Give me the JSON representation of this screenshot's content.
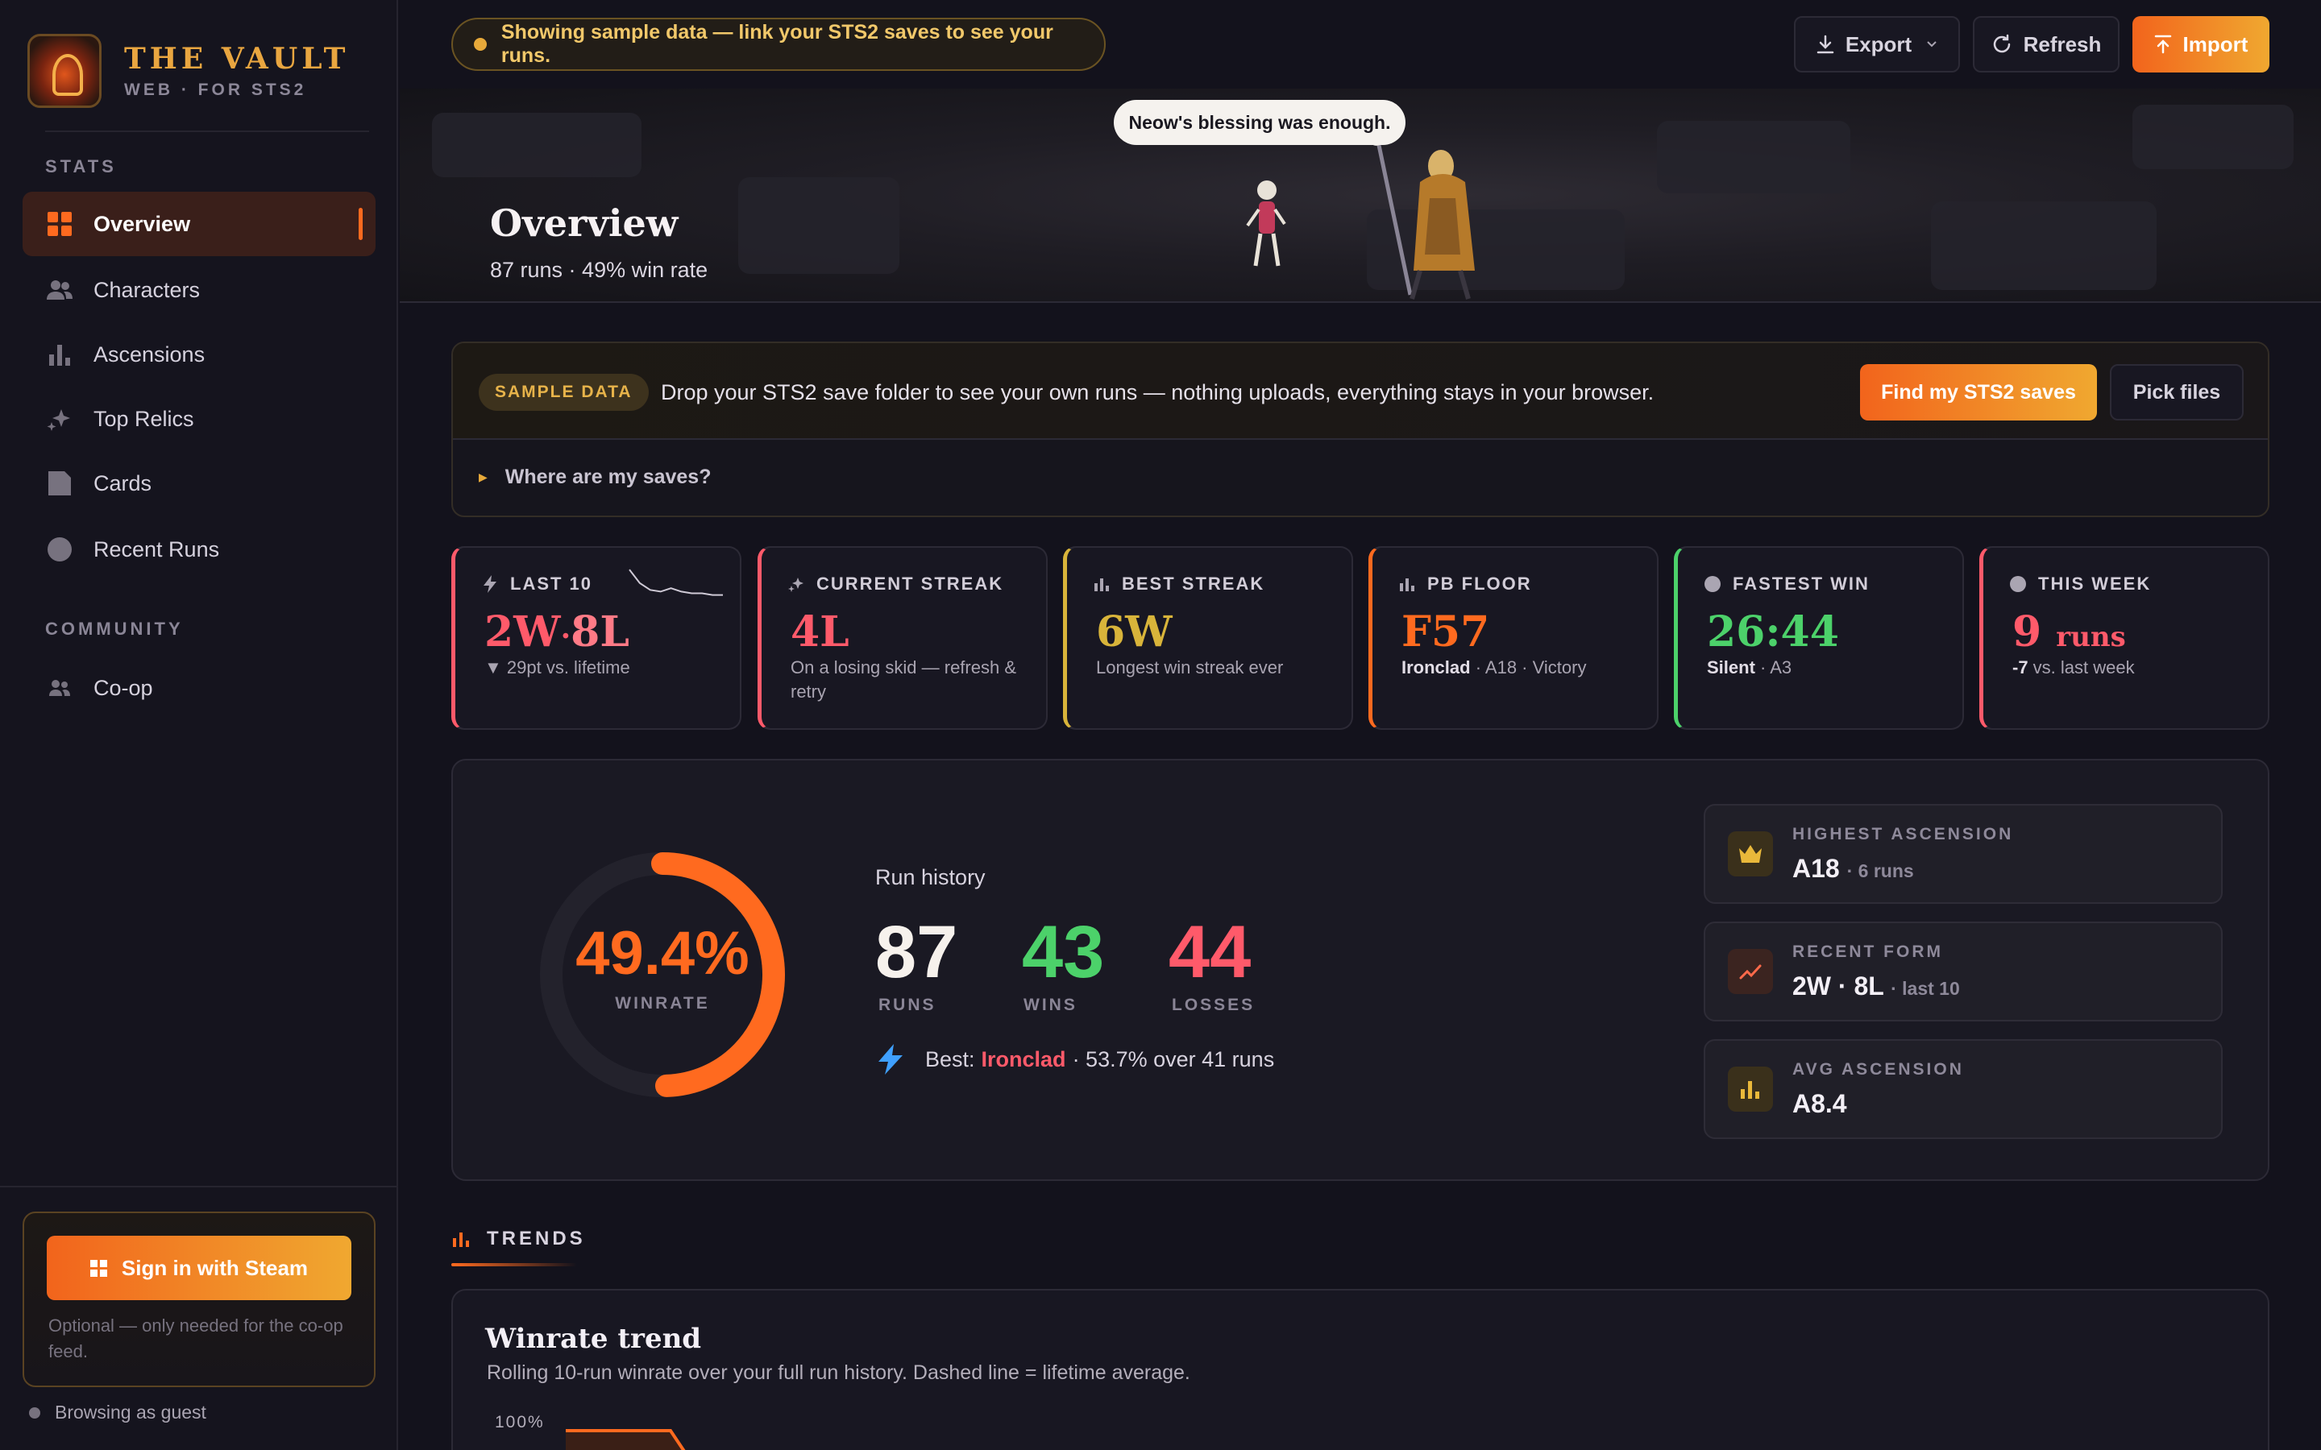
{
  "brand": {
    "title": "THE VAULT",
    "subtitle": "WEB · FOR STS2"
  },
  "sidebar": {
    "section_stats": "STATS",
    "section_community": "COMMUNITY",
    "items": [
      {
        "label": "Overview",
        "icon": "grid-icon",
        "active": true
      },
      {
        "label": "Characters",
        "icon": "users-icon"
      },
      {
        "label": "Ascensions",
        "icon": "bar-chart-icon"
      },
      {
        "label": "Top Relics",
        "icon": "sparkle-icon"
      },
      {
        "label": "Cards",
        "icon": "card-icon"
      },
      {
        "label": "Recent Runs",
        "icon": "circle-icon"
      }
    ],
    "community_items": [
      {
        "label": "Co-op",
        "icon": "users-icon"
      }
    ],
    "steam": {
      "button": "Sign in with Steam",
      "note": "Optional — only needed for the co-op feed."
    },
    "guest": "Browsing as guest"
  },
  "topbar": {
    "sample_notice": "Showing sample data — link your STS2 saves to see your runs.",
    "export": "Export",
    "refresh": "Refresh",
    "import": "Import"
  },
  "hero": {
    "title": "Overview",
    "subtitle": "87 runs · 49% win rate",
    "speech": "Neow's blessing was enough."
  },
  "banner": {
    "badge": "SAMPLE DATA",
    "text": "Drop your STS2 save folder to see your own runs — nothing uploads, everything stays in your browser.",
    "find_button": "Find my STS2 saves",
    "pick_button": "Pick files",
    "where": "Where are my saves?"
  },
  "stats": [
    {
      "label": "LAST 10",
      "value_w": "2W",
      "value_sep": "·",
      "value_l": "8L",
      "note": "▼ 29pt vs. lifetime",
      "accent": "#ff5a6a"
    },
    {
      "label": "CURRENT STREAK",
      "value": "4L",
      "note": "On a losing skid — refresh & retry",
      "accent": "#ff5a6a"
    },
    {
      "label": "BEST STREAK",
      "value": "6W",
      "note": "Longest win streak ever",
      "accent": "#d8b43a"
    },
    {
      "label": "PB FLOOR",
      "value": "F57",
      "note_bold": "Ironclad",
      "note": " · A18 · Victory",
      "accent": "#ff6a1f"
    },
    {
      "label": "FASTEST WIN",
      "value": "26:44",
      "note_bold": "Silent",
      "note": " · A3",
      "accent": "#4cd16a"
    },
    {
      "label": "THIS WEEK",
      "value_num": "9",
      "value_unit": "runs",
      "note_bold": "-7",
      "note": " vs. last week",
      "accent": "#ff5a6a"
    }
  ],
  "last10_sparkline": [
    0.95,
    0.55,
    0.35,
    0.3,
    0.4,
    0.3,
    0.25,
    0.25,
    0.2,
    0.2
  ],
  "summary": {
    "winrate_pct": "49.4%",
    "winrate_value": 49.4,
    "winrate_label": "WINRATE",
    "history_title": "Run history",
    "runs": "87",
    "runs_label": "RUNS",
    "wins": "43",
    "wins_label": "WINS",
    "losses": "44",
    "losses_label": "LOSSES",
    "best_prefix": "Best:",
    "best_char": "Ironclad",
    "best_suffix": "· 53.7% over 41 runs"
  },
  "mini_cards": [
    {
      "label": "HIGHEST ASCENSION",
      "value": "A18",
      "extra": "· 6 runs",
      "icon": "crown-icon"
    },
    {
      "label": "RECENT FORM",
      "value": "2W · 8L",
      "extra": "· last 10",
      "icon": "trend-icon"
    },
    {
      "label": "AVG ASCENSION",
      "value": "A8.4",
      "extra": "",
      "icon": "bar-chart-icon"
    }
  ],
  "trends": {
    "heading": "TRENDS",
    "card_title": "Winrate trend",
    "card_sub": "Rolling 10-run winrate over your full run history. Dashed line = lifetime average.",
    "y_top": "100%"
  },
  "colors": {
    "accent": "#ff6a1f",
    "gold": "#e9a640",
    "win": "#4cd16a",
    "loss": "#ff5a6a",
    "background": "#13121c"
  }
}
